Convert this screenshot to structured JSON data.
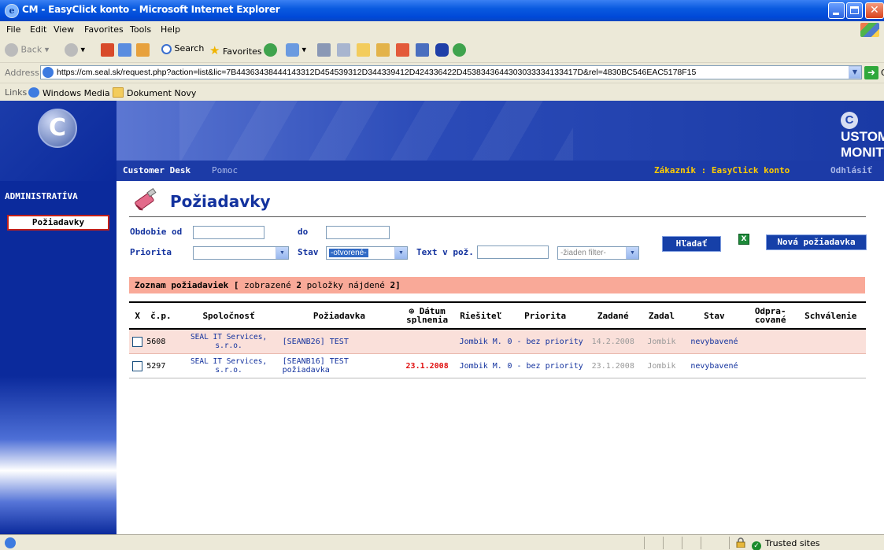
{
  "window": {
    "title": "CM - EasyClick konto - Microsoft Internet Explorer"
  },
  "menu": [
    "File",
    "Edit",
    "View",
    "Favorites",
    "Tools",
    "Help"
  ],
  "toolbar": {
    "back": "Back",
    "search": "Search",
    "favorites": "Favorites"
  },
  "address": {
    "label": "Address",
    "url": "https://cm.seal.sk/request.php?action=list&lic=7B44363438444143312D454539312D344339412D424336422D4538343644303033334133417D&rel=4830BC546EAC5178F15",
    "go": "Go"
  },
  "links": {
    "label": "Links",
    "items": [
      "Windows Media",
      "Dokument Novy"
    ]
  },
  "site": {
    "brand_c": "C",
    "brand_rest": "USTOMER MONITOR",
    "logo_letter": "C",
    "nav": {
      "desk": "Customer Desk",
      "help": "Pomoc",
      "customer": "Zákazník : EasyClick konto",
      "logout": "Odhlásiť"
    },
    "sidebar": {
      "title": "ADMINISTRATÍVA",
      "item": "Požiadavky"
    }
  },
  "page": {
    "title": "Požiadavky",
    "filters": {
      "period_from": "Obdobie od",
      "period_to": "do",
      "priority": "Priorita",
      "status": "Stav",
      "status_value": "-otvorené-",
      "text_in": "Text v pož.",
      "filter_value": "-žiaden filter-"
    },
    "buttons": {
      "search": "Hľadať",
      "new": "Nová požiadavka",
      "excel": "X"
    },
    "list": {
      "label": "Zoznam požiadaviek",
      "open": "[",
      "shown_text": "zobrazené",
      "shown": "2",
      "found_text": "položky nájdené",
      "found": "2",
      "close": "]"
    }
  },
  "table": {
    "columns": [
      "X",
      "č.p.",
      "Spoločnosť",
      "Požiadavka",
      "Dátum splnenia",
      "Riešiteľ",
      "Priorita",
      "Zadané",
      "Zadal",
      "Stav",
      "Odpra-cované",
      "Schválenie"
    ],
    "rows": [
      {
        "num": "5608",
        "company": "SEAL IT Services, s.r.o.",
        "request": "[SEANB26] TEST",
        "due": "",
        "solver": "Jombik M.",
        "priority": "0 - bez priority",
        "entered": "14.2.2008",
        "by": "Jombik",
        "status": "nevybavené",
        "worked": "",
        "approval": ""
      },
      {
        "num": "5297",
        "company": "SEAL IT Services, s.r.o.",
        "request": "[SEANB16] TEST požiadavka",
        "due": "23.1.2008",
        "solver": "Jombik M.",
        "priority": "0 - bez priority",
        "entered": "23.1.2008",
        "by": "Jombik",
        "status": "nevybavené",
        "worked": "",
        "approval": ""
      }
    ]
  },
  "status": {
    "zone": "Trusted sites"
  }
}
